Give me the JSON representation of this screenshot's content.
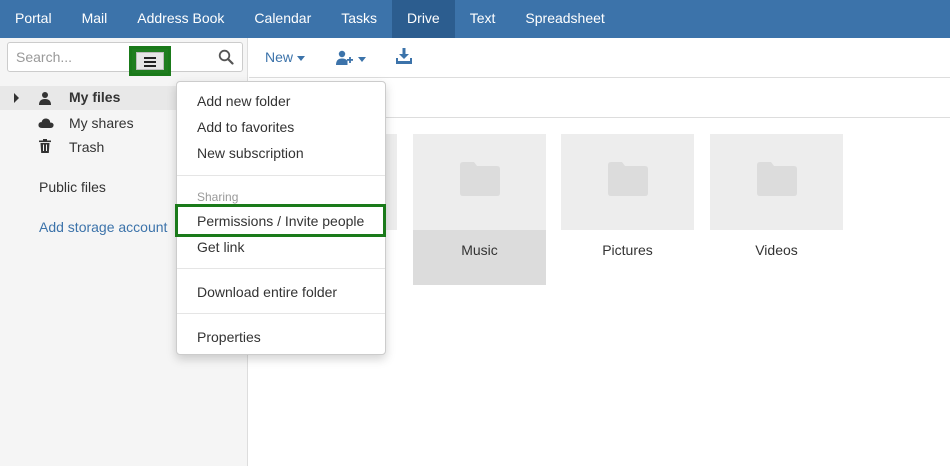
{
  "nav": {
    "tabs": [
      {
        "label": "Portal"
      },
      {
        "label": "Mail"
      },
      {
        "label": "Address Book"
      },
      {
        "label": "Calendar"
      },
      {
        "label": "Tasks"
      },
      {
        "label": "Drive",
        "active": true
      },
      {
        "label": "Text"
      },
      {
        "label": "Spreadsheet"
      }
    ]
  },
  "sidebar": {
    "search_placeholder": "Search...",
    "my_files": "My files",
    "my_shares": "My shares",
    "trash": "Trash",
    "public_files": "Public files",
    "add_storage": "Add storage account"
  },
  "toolbar": {
    "new_label": "New"
  },
  "folders": [
    {
      "name": "Music"
    },
    {
      "name": "Pictures"
    },
    {
      "name": "Videos"
    }
  ],
  "context_menu": {
    "add_new_folder": "Add new folder",
    "add_to_favorites": "Add to favorites",
    "new_subscription": "New subscription",
    "sharing_header": "Sharing",
    "permissions": "Permissions / Invite people",
    "get_link": "Get link",
    "download_folder": "Download entire folder",
    "properties": "Properties"
  },
  "colors": {
    "brand": "#3c73aa",
    "highlight": "#1a7a1a"
  }
}
